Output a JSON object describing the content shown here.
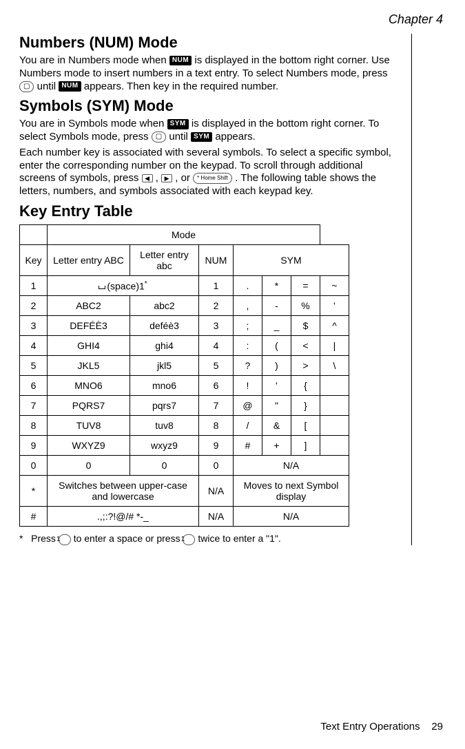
{
  "chapter_label": "Chapter 4",
  "sections": {
    "num_mode": {
      "title": "Numbers (NUM) Mode",
      "p1a": "You are in Numbers mode when ",
      "p1b": " is displayed in the bottom right corner. Use Numbers mode to insert numbers in a text entry. To select Numbers mode, press ",
      "p1c": " until ",
      "p1d": " appears. Then key in the required number.",
      "badge": "NUM"
    },
    "sym_mode": {
      "title": "Symbols (SYM) Mode",
      "p1a": "You are in Symbols mode when ",
      "p1b": " is displayed in the bottom right corner. To select Symbols mode, press ",
      "p1c": " until ",
      "p1d": " appears.",
      "p2a": "Each number key is associated with several symbols. To select a specific symbol, enter the corresponding number on the keypad. To scroll through additional screens of symbols, press ",
      "p2b": " , ",
      "p2c": " , or ",
      "p2d": " . The following table shows the letters, numbers, and symbols associated with each keypad key.",
      "badge": "SYM",
      "shift_key": "* Home Shift"
    },
    "key_table_title": "Key Entry Table"
  },
  "table": {
    "mode_header": "Mode",
    "col_key": "Key",
    "col_abc_upper": "Letter entry ABC",
    "col_abc_lower": "Letter entry abc",
    "col_num": "NUM",
    "col_sym": "SYM",
    "rows": [
      {
        "key": "1",
        "upper": "(space)1",
        "upper_sup": "*",
        "lower_merged": true,
        "num": "1",
        "sym": [
          ".",
          "*",
          "=",
          "~"
        ]
      },
      {
        "key": "2",
        "upper": "ABC2",
        "lower": "abc2",
        "num": "2",
        "sym": [
          ",",
          "-",
          "%",
          "'"
        ]
      },
      {
        "key": "3",
        "upper": "DEFÉÈ3",
        "lower": "deféè3",
        "num": "3",
        "sym": [
          ";",
          "_",
          "$",
          "^"
        ]
      },
      {
        "key": "4",
        "upper": "GHI4",
        "lower": "ghi4",
        "num": "4",
        "sym": [
          ":",
          "(",
          "<",
          "|"
        ]
      },
      {
        "key": "5",
        "upper": "JKL5",
        "lower": "jkl5",
        "num": "5",
        "sym": [
          "?",
          ")",
          ">",
          "\\"
        ]
      },
      {
        "key": "6",
        "upper": "MNO6",
        "lower": "mno6",
        "num": "6",
        "sym": [
          "!",
          "'",
          "{",
          ""
        ]
      },
      {
        "key": "7",
        "upper": "PQRS7",
        "lower": "pqrs7",
        "num": "7",
        "sym": [
          "@",
          "\"",
          "}",
          ""
        ]
      },
      {
        "key": "8",
        "upper": "TUV8",
        "lower": "tuv8",
        "num": "8",
        "sym": [
          "/",
          "&",
          "[",
          ""
        ]
      },
      {
        "key": "9",
        "upper": "WXYZ9",
        "lower": "wxyz9",
        "num": "9",
        "sym": [
          "#",
          "+",
          "]",
          ""
        ]
      },
      {
        "key": "0",
        "upper": "0",
        "lower": "0",
        "num": "0",
        "sym_merged": "N/A"
      },
      {
        "key": "*",
        "upper_merged": "Switches between upper-case and lowercase",
        "num": "N/A",
        "sym_merged": "Moves to next Symbol display"
      },
      {
        "key": "#",
        "upper_merged": ".,;:?!@/# *-_",
        "num": "N/A",
        "sym_merged": "N/A"
      }
    ]
  },
  "footnote": {
    "star": "*",
    "a": "Press ",
    "b": " to enter a space or press ",
    "c": " twice to enter a \"1\".",
    "key": "1"
  },
  "footer": {
    "section": "Text Entry Operations",
    "page": "29"
  }
}
